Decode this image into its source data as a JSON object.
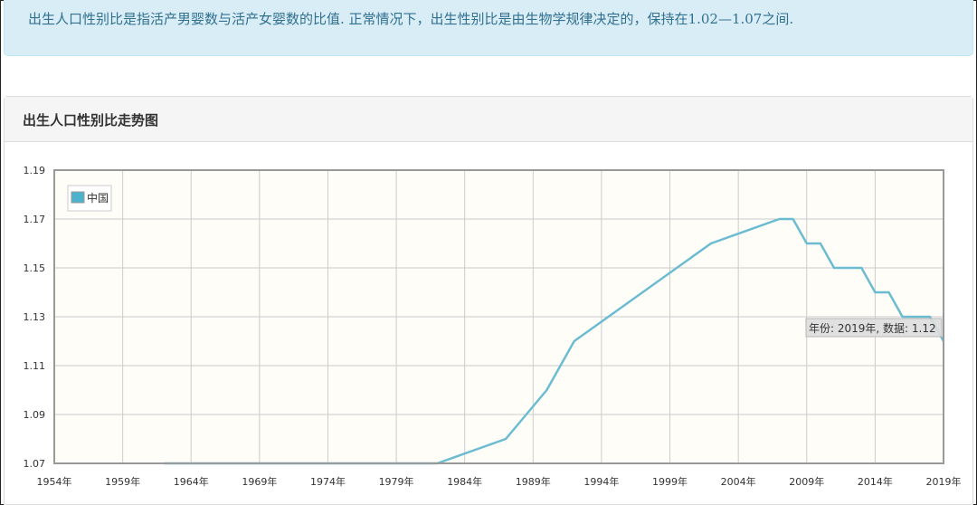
{
  "notice": {
    "text": "出生人口性别比是指活产男婴数与活产女婴数的比值. 正常情况下，出生性别比是由生物学规律决定的，保持在1.02—1.07之间."
  },
  "panel": {
    "title": "出生人口性别比走势图"
  },
  "colors": {
    "series": "#6bbcd1",
    "legend_swatch": "#4db3cc",
    "plot_bg": "#fffdf8",
    "grid": "#cccccc",
    "axis": "#999999"
  },
  "chart_data": {
    "type": "line",
    "title": "",
    "xlabel": "",
    "ylabel": "",
    "xlim": [
      1954,
      2019
    ],
    "ylim": [
      1.07,
      1.19
    ],
    "x_ticks": [
      1954,
      1959,
      1964,
      1969,
      1974,
      1979,
      1984,
      1989,
      1994,
      1999,
      2004,
      2009,
      2014,
      2019
    ],
    "x_tick_labels": [
      "1954年",
      "1959年",
      "1964年",
      "1969年",
      "1974年",
      "1979年",
      "1984年",
      "1989年",
      "1994年",
      "1999年",
      "2004年",
      "2009年",
      "2014年",
      "2019年"
    ],
    "y_ticks": [
      1.07,
      1.09,
      1.11,
      1.13,
      1.15,
      1.17,
      1.19
    ],
    "y_tick_labels": [
      "1.07",
      "1.09",
      "1.11",
      "1.13",
      "1.15",
      "1.17",
      "1.19"
    ],
    "grid": true,
    "legend_position": "top-left",
    "series": [
      {
        "name": "中国",
        "x": [
          1962,
          1982,
          1987,
          1990,
          1992,
          2002,
          2007,
          2008,
          2009,
          2010,
          2011,
          2012,
          2013,
          2014,
          2015,
          2016,
          2017,
          2018,
          2019
        ],
        "y": [
          1.07,
          1.07,
          1.08,
          1.1,
          1.12,
          1.16,
          1.17,
          1.17,
          1.16,
          1.16,
          1.15,
          1.15,
          1.15,
          1.14,
          1.14,
          1.13,
          1.13,
          1.13,
          1.12
        ]
      }
    ],
    "tooltip": {
      "text": "年份: 2019年, 数据: 1.12"
    }
  }
}
